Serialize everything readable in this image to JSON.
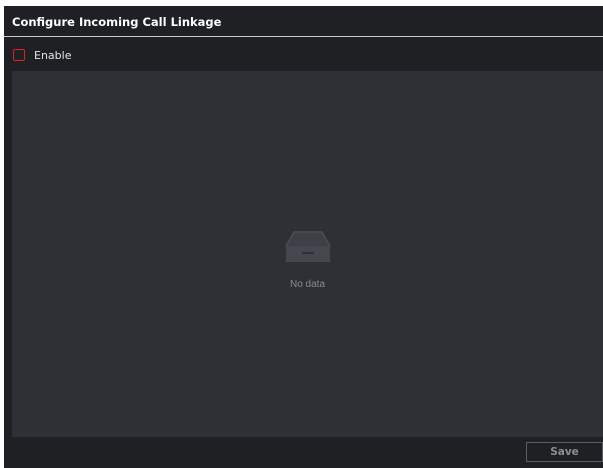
{
  "dialog": {
    "title": "Configure Incoming Call Linkage"
  },
  "enable": {
    "label": "Enable",
    "checked": false
  },
  "content": {
    "empty_icon": "empty-tray-icon",
    "empty_text": "No data"
  },
  "footer": {
    "save_label": "Save"
  },
  "colors": {
    "background": "#1e2024",
    "panel": "#2e3035",
    "checkbox_border": "#d8232a",
    "muted_text": "#8a8c90"
  }
}
